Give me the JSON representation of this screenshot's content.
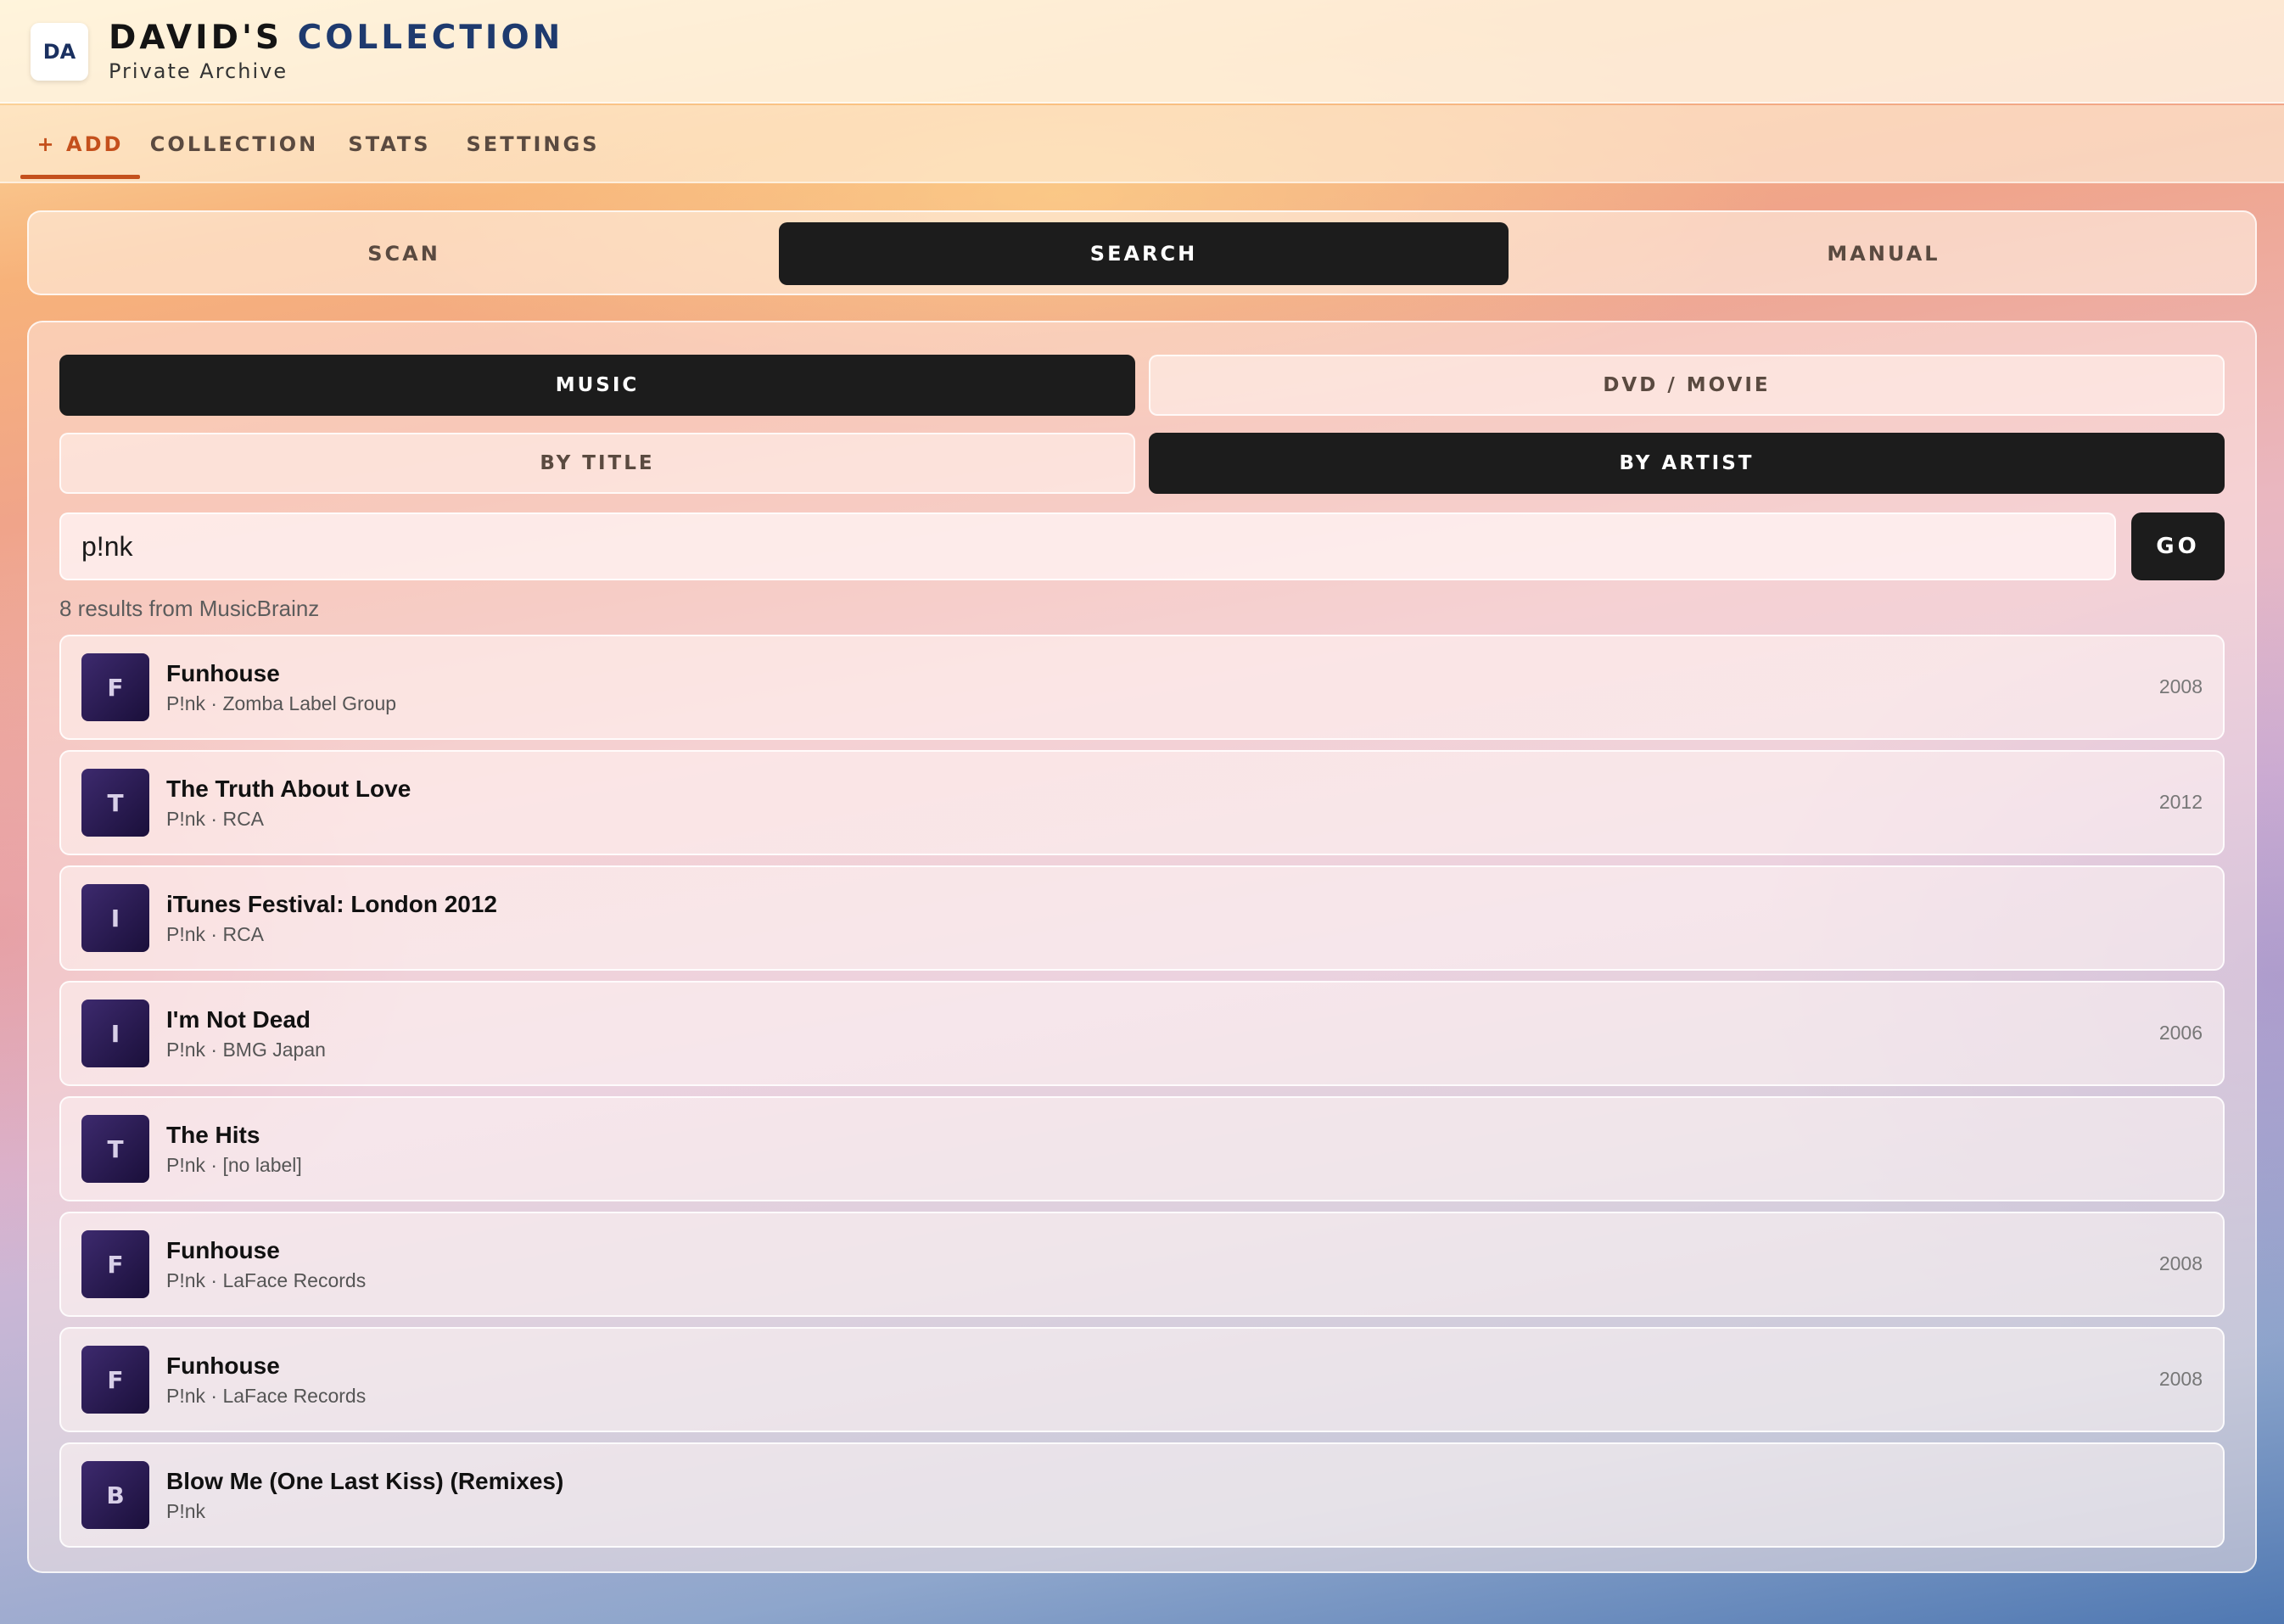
{
  "header": {
    "logo_text": "DA",
    "title_part1": "DAVID'S",
    "title_part2": "COLLECTION",
    "subtitle": "Private Archive"
  },
  "nav": {
    "tabs": [
      {
        "label": "+ ADD",
        "active": true
      },
      {
        "label": "COLLECTION",
        "active": false
      },
      {
        "label": "STATS",
        "active": false
      },
      {
        "label": "SETTINGS",
        "active": false
      }
    ]
  },
  "mode": {
    "buttons": [
      {
        "label": "SCAN",
        "active": false
      },
      {
        "label": "SEARCH",
        "active": true
      },
      {
        "label": "MANUAL",
        "active": false
      }
    ]
  },
  "search": {
    "media_types": [
      {
        "label": "MUSIC",
        "active": true
      },
      {
        "label": "DVD / MOVIE",
        "active": false
      }
    ],
    "search_by": [
      {
        "label": "BY TITLE",
        "active": false
      },
      {
        "label": "BY ARTIST",
        "active": true
      }
    ],
    "query": "p!nk",
    "go_label": "GO",
    "results_info": "8 results from MusicBrainz"
  },
  "results": [
    {
      "initial": "F",
      "title": "Funhouse",
      "subtitle": "P!nk · Zomba Label Group",
      "year": "2008"
    },
    {
      "initial": "T",
      "title": "The Truth About Love",
      "subtitle": "P!nk · RCA",
      "year": "2012"
    },
    {
      "initial": "I",
      "title": "iTunes Festival: London 2012",
      "subtitle": "P!nk · RCA",
      "year": ""
    },
    {
      "initial": "I",
      "title": "I'm Not Dead",
      "subtitle": "P!nk · BMG Japan",
      "year": "2006"
    },
    {
      "initial": "T",
      "title": "The Hits",
      "subtitle": "P!nk · [no label]",
      "year": ""
    },
    {
      "initial": "F",
      "title": "Funhouse",
      "subtitle": "P!nk · LaFace Records",
      "year": "2008"
    },
    {
      "initial": "F",
      "title": "Funhouse",
      "subtitle": "P!nk · LaFace Records",
      "year": "2008"
    },
    {
      "initial": "B",
      "title": "Blow Me (One Last Kiss) (Remixes)",
      "subtitle": "P!nk",
      "year": ""
    }
  ],
  "colors": {
    "accent": "#c4501c",
    "active_button": "#1c1c1c",
    "brand_blue": "#1e3a6e",
    "thumb": "#2a1a52"
  }
}
